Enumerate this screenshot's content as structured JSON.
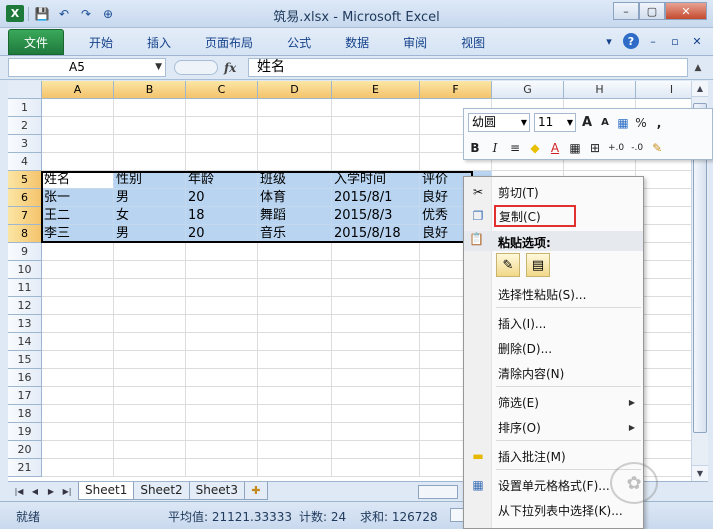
{
  "window": {
    "title": "筑易.xlsx  -  Microsoft Excel",
    "minimize": "–",
    "maximize": "▢",
    "close": "✕"
  },
  "qat": {
    "app_icon": "X",
    "save": "💾",
    "undo": "↶",
    "redo": "↷",
    "custom": "⊕"
  },
  "ribbon": {
    "tabs": [
      "文件",
      "开始",
      "插入",
      "页面布局",
      "公式",
      "数据",
      "审阅",
      "视图"
    ],
    "right_icons": {
      "collapse": "▾",
      "help": "?",
      "wmin": "–",
      "wrestore": "▫",
      "wclose": "✕"
    }
  },
  "formula_bar": {
    "name_box": "A5",
    "fx": "fx",
    "content": "姓名"
  },
  "grid": {
    "columns": [
      "A",
      "B",
      "C",
      "D",
      "E",
      "F",
      "G",
      "H",
      "I"
    ],
    "selected_columns": [
      "A",
      "B",
      "C",
      "D",
      "E",
      "F"
    ],
    "rows": [
      {
        "n": "1",
        "cells": [
          "",
          "",
          "",
          "",
          "",
          "",
          "",
          "",
          ""
        ]
      },
      {
        "n": "2",
        "cells": [
          "",
          "",
          "",
          "",
          "",
          "",
          "",
          "",
          ""
        ]
      },
      {
        "n": "3",
        "cells": [
          "",
          "",
          "",
          "",
          "",
          "",
          "",
          "",
          ""
        ]
      },
      {
        "n": "4",
        "cells": [
          "",
          "",
          "",
          "",
          "",
          "",
          "",
          "",
          ""
        ]
      },
      {
        "n": "5",
        "cells": [
          "姓名",
          "性别",
          "年龄",
          "班级",
          "入学时间",
          "评价",
          "",
          "",
          ""
        ],
        "sel": true
      },
      {
        "n": "6",
        "cells": [
          "张一",
          "男",
          "20",
          "体育",
          "2015/8/1",
          "良好",
          "",
          "",
          ""
        ],
        "sel": true
      },
      {
        "n": "7",
        "cells": [
          "王二",
          "女",
          "18",
          "舞蹈",
          "2015/8/3",
          "优秀",
          "",
          "",
          ""
        ],
        "sel": true
      },
      {
        "n": "8",
        "cells": [
          "李三",
          "男",
          "20",
          "音乐",
          "2015/8/18",
          "良好",
          "",
          "",
          ""
        ],
        "sel": true
      },
      {
        "n": "9",
        "cells": [
          "",
          "",
          "",
          "",
          "",
          "",
          "",
          "",
          ""
        ]
      },
      {
        "n": "10",
        "cells": [
          "",
          "",
          "",
          "",
          "",
          "",
          "",
          "",
          ""
        ]
      },
      {
        "n": "11",
        "cells": [
          "",
          "",
          "",
          "",
          "",
          "",
          "",
          "",
          ""
        ]
      },
      {
        "n": "12",
        "cells": [
          "",
          "",
          "",
          "",
          "",
          "",
          "",
          "",
          ""
        ]
      },
      {
        "n": "13",
        "cells": [
          "",
          "",
          "",
          "",
          "",
          "",
          "",
          "",
          ""
        ]
      },
      {
        "n": "14",
        "cells": [
          "",
          "",
          "",
          "",
          "",
          "",
          "",
          "",
          ""
        ]
      },
      {
        "n": "15",
        "cells": [
          "",
          "",
          "",
          "",
          "",
          "",
          "",
          "",
          ""
        ]
      },
      {
        "n": "16",
        "cells": [
          "",
          "",
          "",
          "",
          "",
          "",
          "",
          "",
          ""
        ]
      },
      {
        "n": "17",
        "cells": [
          "",
          "",
          "",
          "",
          "",
          "",
          "",
          "",
          ""
        ]
      },
      {
        "n": "18",
        "cells": [
          "",
          "",
          "",
          "",
          "",
          "",
          "",
          "",
          ""
        ]
      },
      {
        "n": "19",
        "cells": [
          "",
          "",
          "",
          "",
          "",
          "",
          "",
          "",
          ""
        ]
      },
      {
        "n": "20",
        "cells": [
          "",
          "",
          "",
          "",
          "",
          "",
          "",
          "",
          ""
        ]
      },
      {
        "n": "21",
        "cells": [
          "",
          "",
          "",
          "",
          "",
          "",
          "",
          "",
          ""
        ]
      }
    ]
  },
  "sheets": {
    "tabs": [
      "Sheet1",
      "Sheet2",
      "Sheet3"
    ],
    "active": "Sheet1",
    "new_icon": "✚"
  },
  "status": {
    "ready": "就绪",
    "average": "平均值: 21121.33333",
    "count": "计数: 24",
    "sum": "求和: 126728"
  },
  "mini_toolbar": {
    "font": "幼圆",
    "size": "11",
    "grow": "A",
    "shrink": "A",
    "format_icon": "▦",
    "percent": "%",
    "comma": ",",
    "bold": "B",
    "italic": "I",
    "align": "≡",
    "fill": "◆",
    "font_color": "A",
    "borders": "▦",
    "merge": "⊞",
    "inc_dec": "+.0",
    "dec_dec": "-.0",
    "painter": "✎"
  },
  "context_menu": {
    "cut": "剪切(T)",
    "copy": "复制(C)",
    "paste_header": "粘贴选项:",
    "paste_special": "选择性粘贴(S)...",
    "insert": "插入(I)...",
    "delete": "删除(D)...",
    "clear": "清除内容(N)",
    "filter": "筛选(E)",
    "sort": "排序(O)",
    "insert_comment": "插入批注(M)",
    "format_cells": "设置单元格格式(F)...",
    "pick_list": "从下拉列表中选择(K)..."
  }
}
